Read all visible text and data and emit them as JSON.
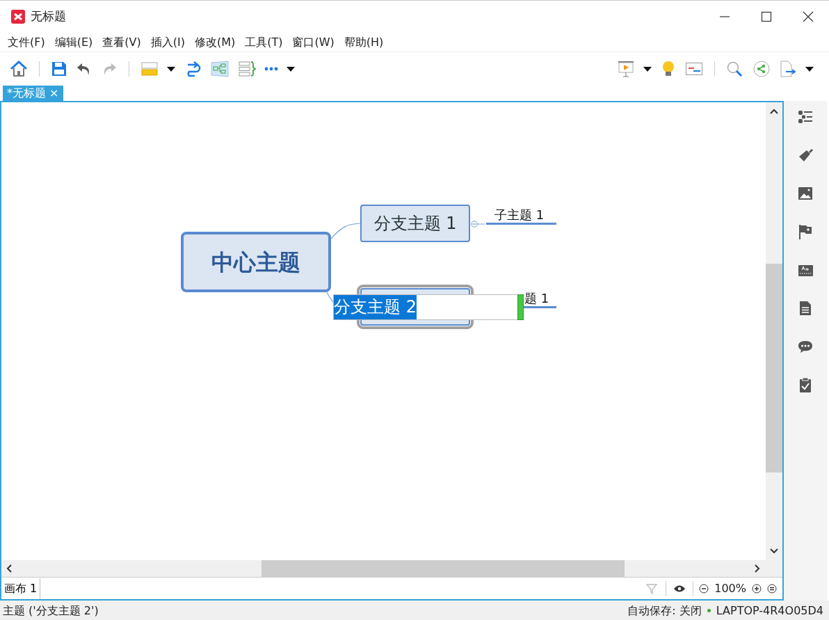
{
  "window": {
    "title": "无标题"
  },
  "menu": [
    "文件(F)",
    "编辑(E)",
    "查看(V)",
    "插入(I)",
    "修改(M)",
    "工具(T)",
    "窗口(W)",
    "帮助(H)"
  ],
  "tabs": [
    {
      "label": "*无标题",
      "selected": true,
      "close": "×"
    }
  ],
  "mind_map": {
    "central_topic": "中心主题",
    "branches": [
      {
        "label": "分支主题 1",
        "selected": false,
        "children": [
          {
            "label": "子主题 1"
          }
        ]
      },
      {
        "selected": true,
        "children": [
          {
            "label": "题 1"
          }
        ]
      }
    ],
    "editor": {
      "value": "分支主题 2",
      "text_selected": true
    }
  },
  "sheet_tabs": [
    {
      "label": "画布 1",
      "selected": true
    }
  ],
  "zoom": "100%",
  "status_bar": {
    "selection": "主题 ('分支主题 2')",
    "autosave": "自动保存: 关闭",
    "computer": "LAPTOP-4R4O05D4"
  }
}
